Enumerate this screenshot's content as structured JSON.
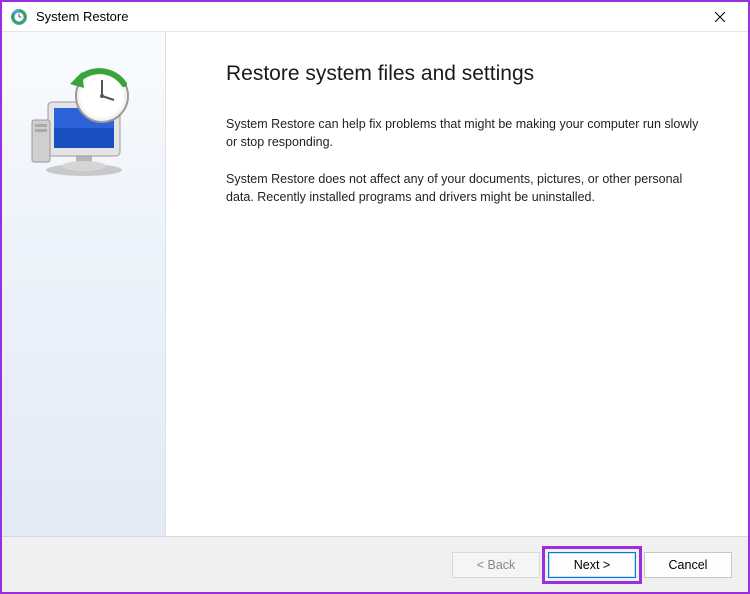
{
  "window": {
    "title": "System Restore",
    "close_label": "Close"
  },
  "content": {
    "heading": "Restore system files and settings",
    "para1": "System Restore can help fix problems that might be making your computer run slowly or stop responding.",
    "para2": "System Restore does not affect any of your documents, pictures, or other personal data. Recently installed programs and drivers might be uninstalled."
  },
  "buttons": {
    "back": "< Back",
    "next": "Next >",
    "cancel": "Cancel"
  }
}
